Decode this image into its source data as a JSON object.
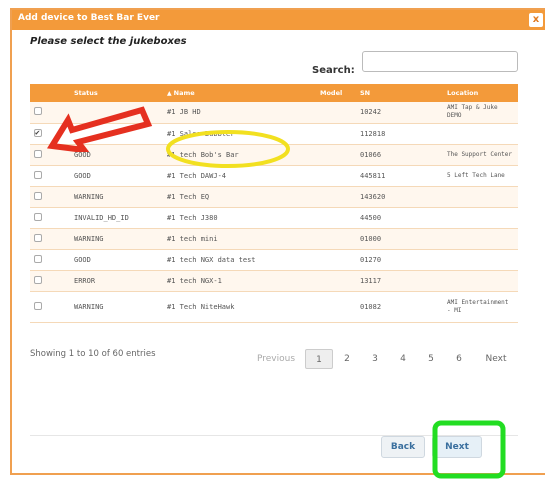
{
  "dialog": {
    "title": "Add device to Best Bar Ever",
    "close_glyph": "x",
    "heading": "Please select the jukeboxes"
  },
  "search": {
    "label": "Search:",
    "value": ""
  },
  "table": {
    "columns": [
      "",
      "Status",
      "Name",
      "Model",
      "SN",
      "Location"
    ],
    "rows": [
      {
        "checked": false,
        "status": "",
        "name": "#1 JB HD",
        "model": "",
        "sn": "10242",
        "location": "AMI Tap & Juke DEMO"
      },
      {
        "checked": true,
        "status": "",
        "name": "#1 Sales Bubbler",
        "model": "",
        "sn": "112818",
        "location": ""
      },
      {
        "checked": false,
        "status": "GOOD",
        "name": "#1 tech Bob's Bar",
        "model": "",
        "sn": "01066",
        "location": "The Support Center"
      },
      {
        "checked": false,
        "status": "GOOD",
        "name": "#1 Tech DAWJ-4",
        "model": "",
        "sn": "445811",
        "location": "5 Left Tech Lane"
      },
      {
        "checked": false,
        "status": "WARNING",
        "name": "#1 Tech EQ",
        "model": "",
        "sn": "143620",
        "location": ""
      },
      {
        "checked": false,
        "status": "INVALID_HD_ID",
        "name": "#1 Tech J380",
        "model": "",
        "sn": "44500",
        "location": ""
      },
      {
        "checked": false,
        "status": "WARNING",
        "name": "#1 tech mini",
        "model": "",
        "sn": "01000",
        "location": ""
      },
      {
        "checked": false,
        "status": "GOOD",
        "name": "#1 tech NGX data test",
        "model": "",
        "sn": "01270",
        "location": ""
      },
      {
        "checked": false,
        "status": "ERROR",
        "name": "#1 tech NGX-1",
        "model": "",
        "sn": "13117",
        "location": ""
      },
      {
        "checked": false,
        "status": "WARNING",
        "name": "#1 Tech NiteHawk",
        "model": "",
        "sn": "01082",
        "location": "AMI Entertainment - MI"
      }
    ]
  },
  "info": {
    "showing": "Showing 1 to 10 of 60 entries"
  },
  "pagination": {
    "previous": "Previous",
    "pages": [
      "1",
      "2",
      "3",
      "4",
      "5",
      "6"
    ],
    "active_page": "1",
    "next": "Next"
  },
  "footer": {
    "back_label": "Back",
    "next_label": "Next"
  },
  "colors": {
    "accent": "#f39a3a",
    "arrow_annotation": "#e53020",
    "circle_annotation": "#f2e020",
    "box_annotation": "#22dd22"
  },
  "icons": {
    "sort": "sort-icon",
    "check": "check-icon"
  }
}
